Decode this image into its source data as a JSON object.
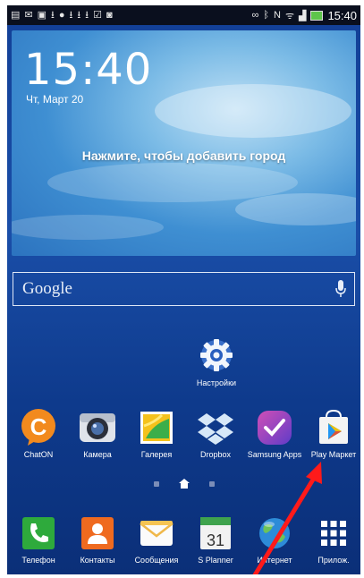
{
  "status_bar": {
    "time": "15:40",
    "left_icons": [
      "document-icon",
      "mail-icon",
      "image-icon",
      "download-icon",
      "person-icon",
      "download-icon",
      "download-icon",
      "download-icon",
      "clipboard-icon",
      "camera-icon"
    ],
    "right_icons": [
      "nfc-icon",
      "bluetooth-icon",
      "nfc-tag-icon",
      "wifi-icon",
      "signal-icon",
      "battery-icon"
    ]
  },
  "clock": {
    "time": "15:40",
    "date": "Чт, Март 20"
  },
  "weather": {
    "hint": "Нажмите, чтобы добавить город"
  },
  "google_search": {
    "label": "Google"
  },
  "settings_app": {
    "label": "Настройки"
  },
  "apps": [
    {
      "name": "chaton",
      "label": "ChatON"
    },
    {
      "name": "camera",
      "label": "Камера"
    },
    {
      "name": "gallery",
      "label": "Галерея"
    },
    {
      "name": "dropbox",
      "label": "Dropbox"
    },
    {
      "name": "samsung-apps",
      "label": "Samsung Apps"
    },
    {
      "name": "play-market",
      "label": "Play Маркет"
    }
  ],
  "dock": [
    {
      "name": "phone",
      "label": "Телефон"
    },
    {
      "name": "contacts",
      "label": "Контакты"
    },
    {
      "name": "messages",
      "label": "Сообщения"
    },
    {
      "name": "splanner",
      "label": "S Planner",
      "calendar_day": "31"
    },
    {
      "name": "internet",
      "label": "Интернет"
    },
    {
      "name": "apps",
      "label": "Прилож."
    }
  ],
  "colors": {
    "annotation_arrow": "#ff1a1a",
    "chaton": "#f28a1e",
    "contacts": "#ef6a1f",
    "phone": "#2eaa3c"
  }
}
